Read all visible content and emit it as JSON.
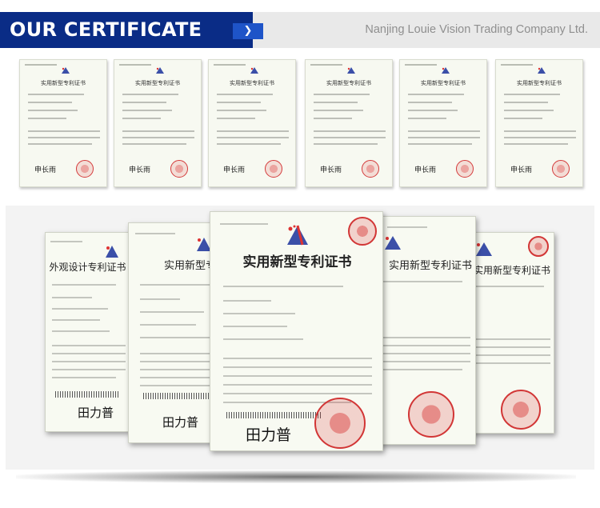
{
  "header": {
    "title": "OUR CERTIFICATE",
    "company": "Nanjing Louie Vision Trading Company Ltd.",
    "arrow_icon": "chevron-right-icon"
  },
  "colors": {
    "title_bg": "#0a2c86",
    "arrow_bg": "#1e54c8",
    "strip_bg": "#e9e9e9",
    "seal": "#d23636"
  },
  "small_certificates": [
    {
      "title": "实用新型专利证书",
      "signature": "申长雨"
    },
    {
      "title": "实用新型专利证书",
      "signature": "申长雨"
    },
    {
      "title": "实用新型专利证书",
      "signature": "申长雨"
    },
    {
      "title": "实用新型专利证书",
      "signature": "申长雨"
    },
    {
      "title": "实用新型专利证书",
      "signature": "申长雨"
    },
    {
      "title": "实用新型专利证书",
      "signature": "申长雨"
    }
  ],
  "large_certificates": [
    {
      "title": "外观设计专利证书",
      "signature": "田力普"
    },
    {
      "title": "实用新型专利证书",
      "signature": "田力普"
    },
    {
      "title": "实用新型专利证书",
      "signature": "田力普"
    },
    {
      "title": "实用新型专利证书",
      "signature": ""
    },
    {
      "title": "实用新型专利证书",
      "signature": ""
    }
  ]
}
